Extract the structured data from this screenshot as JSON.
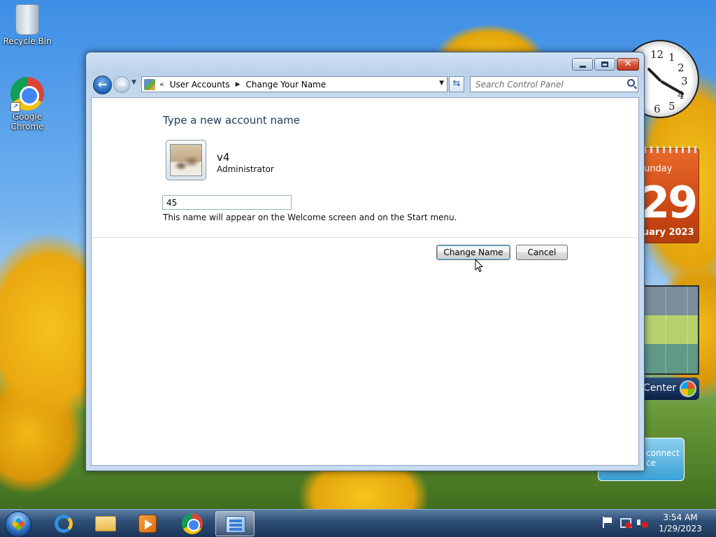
{
  "desktop": {
    "icons": [
      {
        "label": "Recycle Bin"
      },
      {
        "label": "Google Chrome"
      }
    ],
    "gadgets": {
      "clock": {
        "numbers": [
          "12",
          "3",
          "6",
          "1",
          "2",
          "4",
          "5"
        ]
      },
      "calendar": {
        "day": "unday",
        "date": "29",
        "month": "uary 2023"
      },
      "media_center": {
        "label": "Center"
      },
      "connect": {
        "line1": "connect",
        "line2": "ce"
      }
    }
  },
  "window": {
    "address": {
      "separator": "«",
      "crumbs": [
        "User Accounts",
        "Change Your Name"
      ]
    },
    "search": {
      "placeholder": "Search Control Panel"
    },
    "content": {
      "heading": "Type a new account name",
      "user": {
        "name": "v4",
        "role": "Administrator"
      },
      "name_input": {
        "value": "45"
      },
      "hint": "This name will appear on the Welcome screen and on the Start menu.",
      "buttons": {
        "change": "Change Name",
        "cancel": "Cancel"
      }
    }
  },
  "taskbar": {
    "apps": [
      "internet-explorer",
      "windows-explorer",
      "windows-media-player",
      "google-chrome",
      "control-panel"
    ],
    "active_app": "control-panel",
    "clock": {
      "time": "3:54 AM",
      "date": "1/29/2023"
    }
  }
}
